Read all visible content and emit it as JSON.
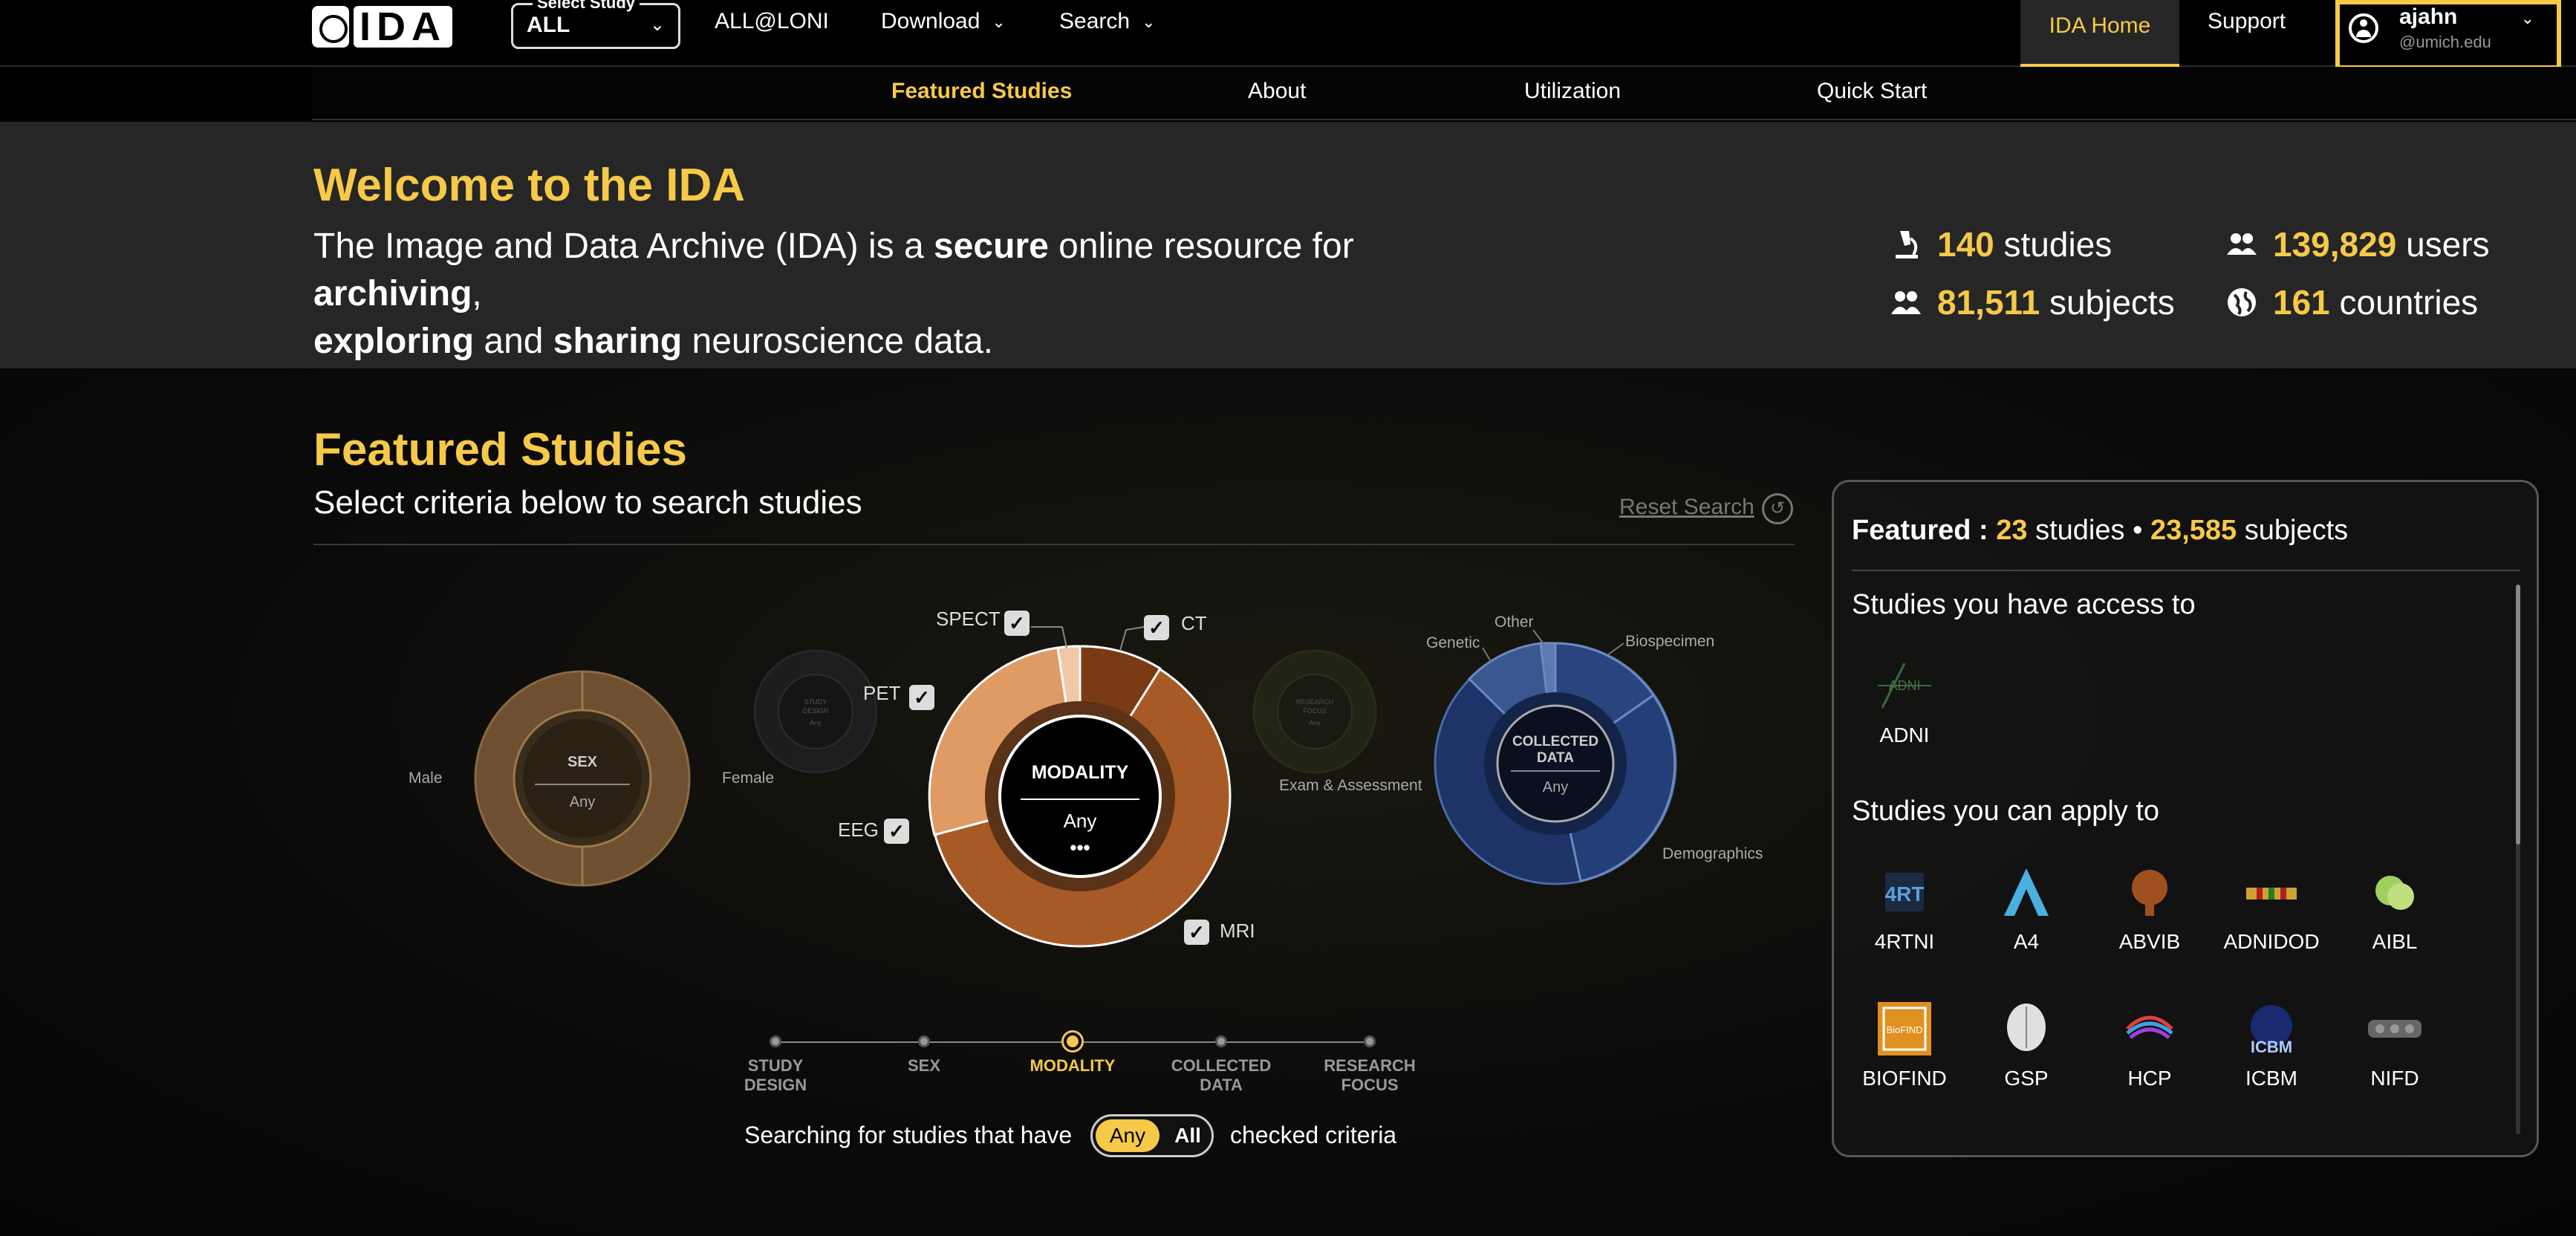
{
  "header": {
    "logo_text": "IDA",
    "select_study": {
      "label": "Select Study",
      "value": "ALL"
    },
    "nav": [
      {
        "label": "ALL@LONI"
      },
      {
        "label": "Download"
      },
      {
        "label": "Search"
      }
    ],
    "ida_home": "IDA Home",
    "support": "Support",
    "user": {
      "name": "ajahn",
      "email": "@umich.edu"
    }
  },
  "subnav": [
    "Featured Studies",
    "About",
    "Utilization",
    "Quick Start"
  ],
  "welcome": {
    "title": "Welcome to the IDA",
    "desc_1": "The Image and Data Archive (IDA) is a ",
    "desc_b1": "secure",
    "desc_2": " online resource for ",
    "desc_b2": "archiving",
    "desc_3": ",",
    "desc_b3": "exploring",
    "desc_4": " and ",
    "desc_b4": "sharing",
    "desc_5": " neuroscience data.",
    "stats": [
      {
        "num": "140",
        "label": "studies",
        "icon": "microscope-icon"
      },
      {
        "num": "139,829",
        "label": "users",
        "icon": "users-icon"
      },
      {
        "num": "81,511",
        "label": "subjects",
        "icon": "subjects-icon"
      },
      {
        "num": "161",
        "label": "countries",
        "icon": "globe-icon"
      }
    ]
  },
  "featured": {
    "title": "Featured Studies",
    "subtitle": "Select criteria below to search studies",
    "reset": "Reset Search",
    "sex": {
      "title": "SEX",
      "value": "Any",
      "left": "Male",
      "right": "Female"
    },
    "study_design": {
      "title": "STUDY DESIGN",
      "value": "Any"
    },
    "modality": {
      "title": "MODALITY",
      "value": "Any",
      "more": "•••",
      "labels": [
        "SPECT",
        "CT",
        "PET",
        "EEG",
        "MRI"
      ]
    },
    "research_focus": {
      "title": "RESEARCH FOCUS",
      "value": "Any"
    },
    "collected": {
      "title": "COLLECTED DATA",
      "value": "Any",
      "labels": [
        "Other",
        "Genetic",
        "Biospecimen",
        "Exam & Assessment",
        "Demographics"
      ]
    },
    "timeline": [
      "STUDY DESIGN",
      "SEX",
      "MODALITY",
      "COLLECTED DATA",
      "RESEARCH FOCUS"
    ],
    "search_prefix": "Searching for studies that have",
    "search_any": "Any",
    "search_all": "All",
    "search_suffix": "checked criteria"
  },
  "panel": {
    "featured_label": "Featured :",
    "studies_num": "23",
    "studies_word": "studies",
    "bullet": "•",
    "subjects_num": "23,585",
    "subjects_word": "subjects",
    "access_title": "Studies you have access to",
    "access": [
      "ADNI"
    ],
    "apply_title": "Studies you can apply to",
    "apply": [
      "4RTNI",
      "A4",
      "ABVIB",
      "ADNIDOD",
      "AIBL",
      "BIOFIND",
      "GSP",
      "HCP",
      "ICBM",
      "NIFD"
    ]
  },
  "colors": {
    "accent": "#f7c948",
    "modality": "#b0602a",
    "sex": "#7a5a30",
    "collected": "#2b4478"
  }
}
